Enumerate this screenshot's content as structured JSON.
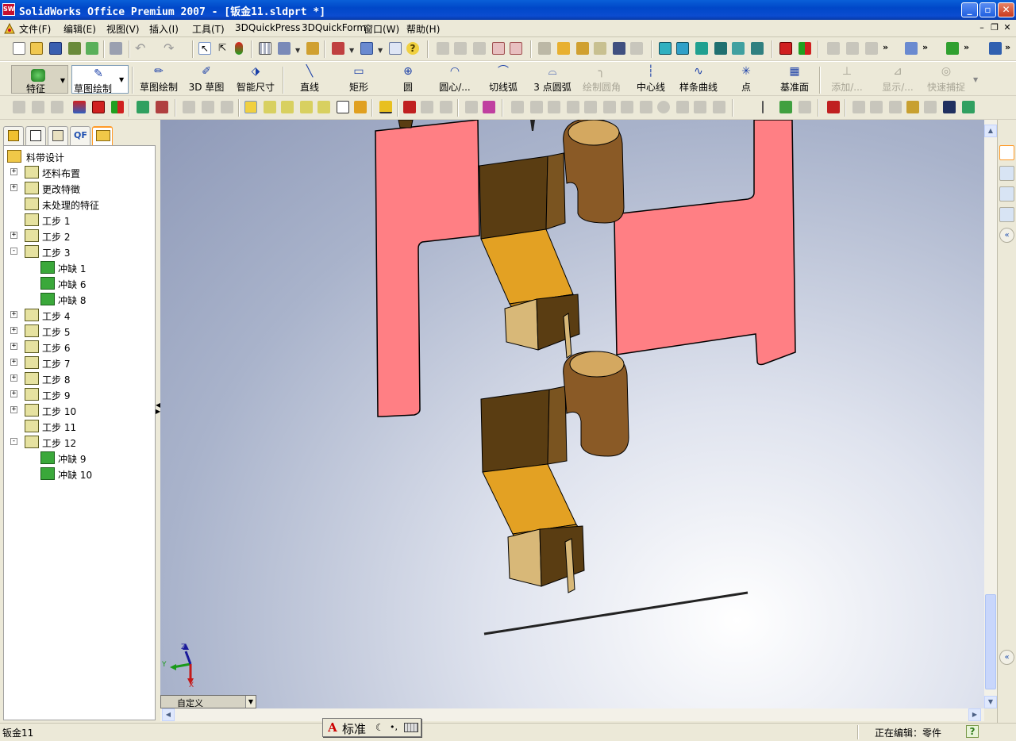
{
  "window": {
    "title": "SolidWorks Office Premium 2007 - [钣金11.sldprt *]",
    "app_icon_text": "SW"
  },
  "menubar": {
    "items": [
      "文件(F)",
      "编辑(E)",
      "视图(V)",
      "插入(I)",
      "工具(T)",
      "3DQuickPress",
      "3DQuickForm",
      "窗口(W)",
      "帮助(H)"
    ]
  },
  "command_manager": {
    "items": [
      {
        "label": "特征",
        "icon": "feature-icon",
        "enabled": true
      },
      {
        "label": "草图绘制",
        "icon": "sketch-icon",
        "enabled": true
      },
      {
        "label": "草图绘制",
        "icon": "sketch-draw-icon",
        "enabled": true
      },
      {
        "label": "3D 草图",
        "icon": "3d-sketch-icon",
        "enabled": true
      },
      {
        "label": "智能尺寸",
        "icon": "smart-dimension-icon",
        "enabled": true
      },
      {
        "label": "直线",
        "icon": "line-icon",
        "enabled": true
      },
      {
        "label": "矩形",
        "icon": "rectangle-icon",
        "enabled": true
      },
      {
        "label": "圆",
        "icon": "circle-icon",
        "enabled": true
      },
      {
        "label": "圆心/...",
        "icon": "center-arc-icon",
        "enabled": true
      },
      {
        "label": "切线弧",
        "icon": "tangent-arc-icon",
        "enabled": true
      },
      {
        "label": "3 点圆弧",
        "icon": "three-point-arc-icon",
        "enabled": true
      },
      {
        "label": "绘制圆角",
        "icon": "sketch-fillet-icon",
        "enabled": false
      },
      {
        "label": "中心线",
        "icon": "centerline-icon",
        "enabled": true
      },
      {
        "label": "样条曲线",
        "icon": "spline-icon",
        "enabled": true
      },
      {
        "label": "点",
        "icon": "point-icon",
        "enabled": true
      },
      {
        "label": "基准面",
        "icon": "plane-icon",
        "enabled": true
      },
      {
        "label": "添加/...",
        "icon": "add-relation-icon",
        "enabled": false
      },
      {
        "label": "显示/...",
        "icon": "display-relation-icon",
        "enabled": false
      },
      {
        "label": "快速捕捉",
        "icon": "quick-snap-icon",
        "enabled": false
      }
    ]
  },
  "feature_tree": {
    "root": "料带设计",
    "nodes": [
      {
        "label": "坯料布置",
        "expander": "+",
        "level": 1
      },
      {
        "label": "更改特徵",
        "expander": "+",
        "level": 1
      },
      {
        "label": "未处理的特征",
        "expander": "",
        "level": 1
      },
      {
        "label": "工步 1",
        "expander": "",
        "level": 1
      },
      {
        "label": "工步 2",
        "expander": "+",
        "level": 1
      },
      {
        "label": "工步 3",
        "expander": "-",
        "level": 1
      },
      {
        "label": "冲缺 1",
        "expander": "",
        "level": 2
      },
      {
        "label": "冲缺 6",
        "expander": "",
        "level": 2
      },
      {
        "label": "冲缺 8",
        "expander": "",
        "level": 2
      },
      {
        "label": "工步 4",
        "expander": "+",
        "level": 1
      },
      {
        "label": "工步 5",
        "expander": "+",
        "level": 1
      },
      {
        "label": "工步 6",
        "expander": "+",
        "level": 1
      },
      {
        "label": "工步 7",
        "expander": "+",
        "level": 1
      },
      {
        "label": "工步 8",
        "expander": "+",
        "level": 1
      },
      {
        "label": "工步 9",
        "expander": "+",
        "level": 1
      },
      {
        "label": "工步 10",
        "expander": "+",
        "level": 1
      },
      {
        "label": "工步 11",
        "expander": "",
        "level": 1
      },
      {
        "label": "工步 12",
        "expander": "-",
        "level": 1
      },
      {
        "label": "冲缺 9",
        "expander": "",
        "level": 2
      },
      {
        "label": "冲缺 10",
        "expander": "",
        "level": 2
      }
    ]
  },
  "feature_manager_tabs": [
    "feature-manager-tab",
    "property-manager-tab",
    "configuration-manager-tab",
    "QF",
    "strip-layout-tab"
  ],
  "view": {
    "orientation_label": "自定义",
    "triad": {
      "x": "X",
      "y": "Y",
      "z": "Z"
    }
  },
  "statusbar": {
    "document": "钣金11",
    "editing": "正在编辑：零件",
    "help": "?"
  },
  "ime": {
    "mode_letter": "A",
    "mode": "标准"
  },
  "colors": {
    "strip_pink": "#ff7f84",
    "formed_brown": "#5a3d12",
    "formed_gold": "#e3a123",
    "cylinder_bronze": "#8a5a26",
    "titlebar": "#0a5fd8",
    "background": "#ece9d8"
  }
}
